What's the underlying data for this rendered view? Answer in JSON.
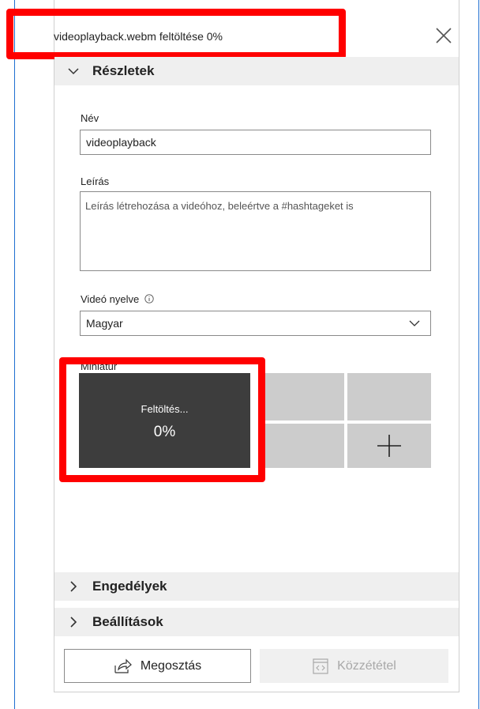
{
  "dialog": {
    "title": "videoplayback.webm feltöltése 0%"
  },
  "details": {
    "header": "Részletek",
    "name_label": "Név",
    "name_value": "videoplayback",
    "description_label": "Leírás",
    "description_placeholder": "Leírás létrehozása a videóhoz, beleértve a #hashtageket is",
    "language_label": "Videó nyelve",
    "language_value": "Magyar",
    "thumbnail_label": "Miniatűr",
    "upload_text": "Feltöltés...",
    "upload_percent": "0%",
    "upload_progress": 0
  },
  "sections": {
    "permissions": "Engedélyek",
    "settings": "Beállítások"
  },
  "buttons": {
    "share": "Megosztás",
    "publish": "Közzététel"
  },
  "icons": {
    "close": "close-icon",
    "collapse": "chevron-down-icon",
    "expand": "chevron-right-icon",
    "info": "info-icon",
    "add": "plus-icon",
    "share": "share-icon",
    "publish": "publish-icon"
  },
  "colors": {
    "highlight": "#ff0000",
    "accent_line": "#1f6fd1",
    "thumbnail_bg": "#3d3d3d",
    "tile_bg": "#cccccc"
  }
}
